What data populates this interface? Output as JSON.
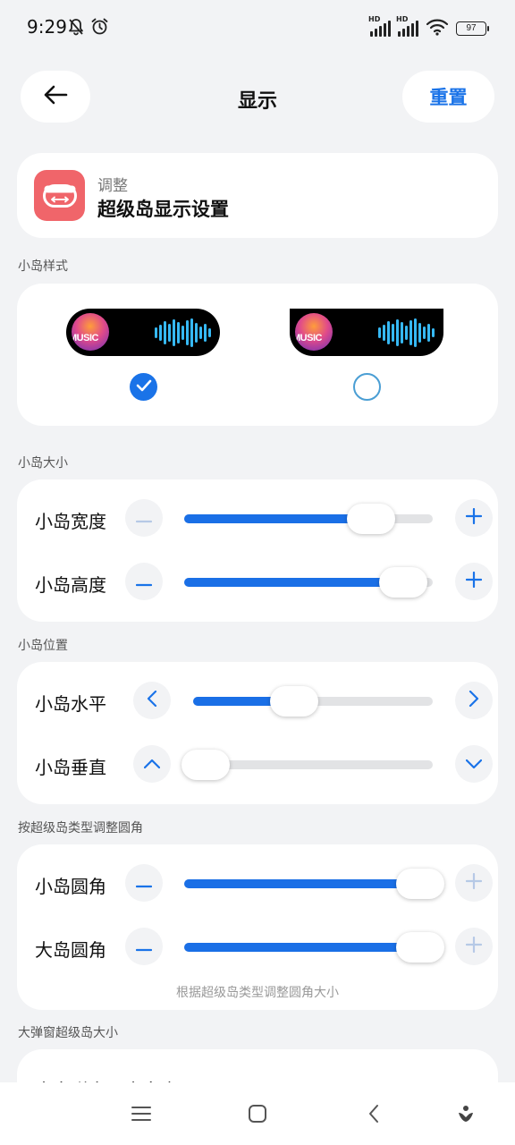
{
  "status_bar": {
    "time": "9:29",
    "signal_1_label": "HD",
    "signal_2_label": "HD",
    "battery": "97",
    "icons": [
      "bell-off-icon",
      "alarm-icon",
      "signal-icon",
      "signal-icon",
      "wifi-icon",
      "battery-icon"
    ]
  },
  "header": {
    "title": "显示",
    "reset_label": "重置",
    "back_icon": "arrow-left-icon"
  },
  "info": {
    "subtitle": "调整",
    "title": "超级岛显示设置",
    "icon": "island-resize-icon",
    "icon_color": "#f0656a"
  },
  "island_style": {
    "section_label": "小岛样式",
    "options": [
      {
        "shape": "pill",
        "album_text": "MUSIC",
        "selected": true
      },
      {
        "shape": "notch",
        "album_text": "MUSIC",
        "selected": false
      }
    ]
  },
  "island_size": {
    "section_label": "小岛大小",
    "rows": [
      {
        "label": "小岛宽度",
        "value_percent": 75
      },
      {
        "label": "小岛高度",
        "value_percent": 88
      }
    ]
  },
  "island_position": {
    "section_label": "小岛位置",
    "rows": [
      {
        "label": "小岛水平",
        "value_percent": 42
      },
      {
        "label": "小岛垂直",
        "value_percent": 5
      }
    ]
  },
  "corner_radius": {
    "section_label": "按超级岛类型调整圆角",
    "rows": [
      {
        "label": "小岛圆角",
        "value_percent": 100
      },
      {
        "label": "大岛圆角",
        "value_percent": 100
      }
    ],
    "hint": "根据超级岛类型调整圆角大小"
  },
  "popup_size": {
    "section_label": "大弹窗超级岛大小",
    "first_row_label": "大岛弹窗最大宽度"
  },
  "colors": {
    "accent": "#1a73e8",
    "slider_fill": "#1a6fe6",
    "wave": "#36b9f5",
    "background": "#f2f3f5"
  },
  "nav_icons": [
    "menu-icon",
    "home-icon",
    "back-icon",
    "assistant-icon"
  ]
}
